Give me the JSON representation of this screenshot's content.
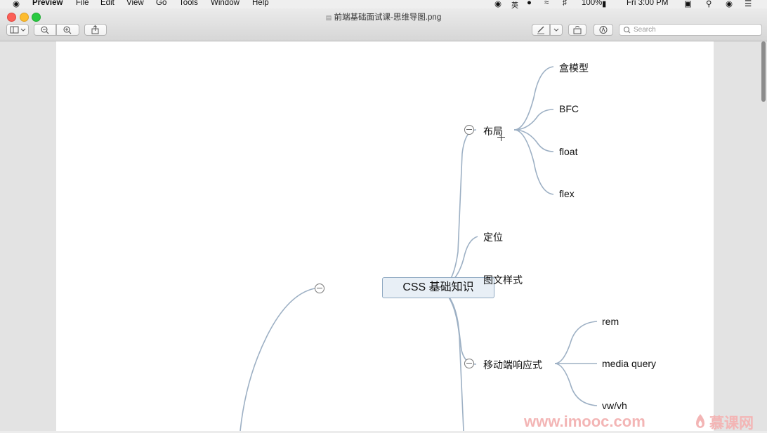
{
  "menubar": {
    "app_name": "Preview",
    "menus": [
      "File",
      "Edit",
      "View",
      "Go",
      "Tools",
      "Window",
      "Help"
    ],
    "status": {
      "battery": "100%",
      "clock": "Fri 3:00 PM"
    }
  },
  "window": {
    "title": "前端基础面试课-思维导图.png",
    "search_placeholder": "Search"
  },
  "mindmap": {
    "root": "CSS 基础知识",
    "branches": [
      {
        "label": "布局",
        "collapsible": true,
        "children": [
          "盒模型",
          "BFC",
          "float",
          "flex"
        ]
      },
      {
        "label": "定位",
        "collapsible": false,
        "children": []
      },
      {
        "label": "图文样式",
        "collapsible": false,
        "children": []
      },
      {
        "label": "移动端响应式",
        "collapsible": true,
        "children": [
          "rem",
          "media query",
          "vw/vh"
        ]
      }
    ]
  },
  "watermark": {
    "site": "www.imooc.com",
    "brand": "慕课网"
  },
  "colors": {
    "connector": "#9db0c4",
    "root_fill": "#e8eff6",
    "root_border": "#8fa9c2",
    "watermark": "#f3b5b5"
  }
}
